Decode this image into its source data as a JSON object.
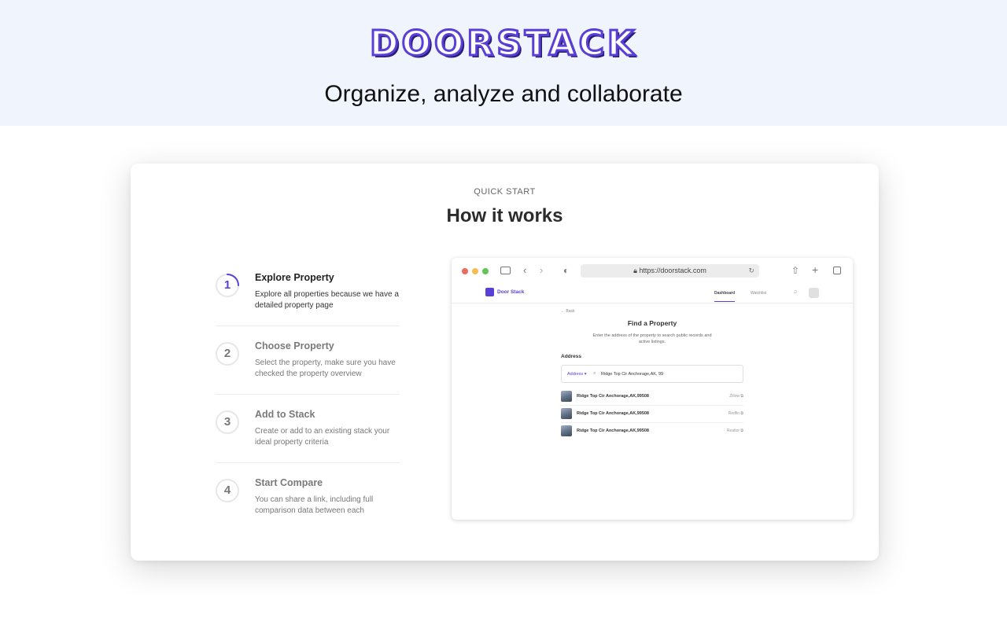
{
  "hero": {
    "logo_text": "DOORSTACK",
    "tagline": "Organize, analyze and collaborate"
  },
  "section": {
    "eyebrow": "QUICK START",
    "heading": "How it works"
  },
  "steps": [
    {
      "number": "1",
      "title": "Explore Property",
      "description": "Explore all properties because we have a detailed property page",
      "active": true
    },
    {
      "number": "2",
      "title": "Choose Property",
      "description": "Select the property, make sure you have checked the property overview",
      "active": false
    },
    {
      "number": "3",
      "title": "Add to Stack",
      "description": "Create or add to an existing stack your ideal property criteria",
      "active": false
    },
    {
      "number": "4",
      "title": "Start Compare",
      "description": "You can share a link, including full comparison data between each",
      "active": false
    }
  ],
  "browser": {
    "url": "https://doorstack.com",
    "traffic_colors": [
      "#ec6a5e",
      "#f4bf4f",
      "#61c554"
    ],
    "app": {
      "brand": "Door Stack",
      "nav_dashboard": "Dashboard",
      "nav_watchlist": "Watchlist",
      "back": "← Back",
      "find_title": "Find a Property",
      "find_description": "Enter the address of the property to search public records and active listings.",
      "address_label": "Address",
      "address_type": "Address ▾",
      "address_value": "Ridge Top Cir Anchorage,AK, 99",
      "results": [
        {
          "address": "Ridge Top Cir Anchorage,AK,99508",
          "source": "Zillow"
        },
        {
          "address": "Ridge Top Cir Anchorage,AK,99508",
          "source": "Redfin"
        },
        {
          "address": "Ridge Top Cir  Anchorage,AK,99508",
          "source": "Realtor"
        }
      ]
    }
  },
  "colors": {
    "accent": "#5a3fd6",
    "hero_bg": "#eff4fd"
  }
}
